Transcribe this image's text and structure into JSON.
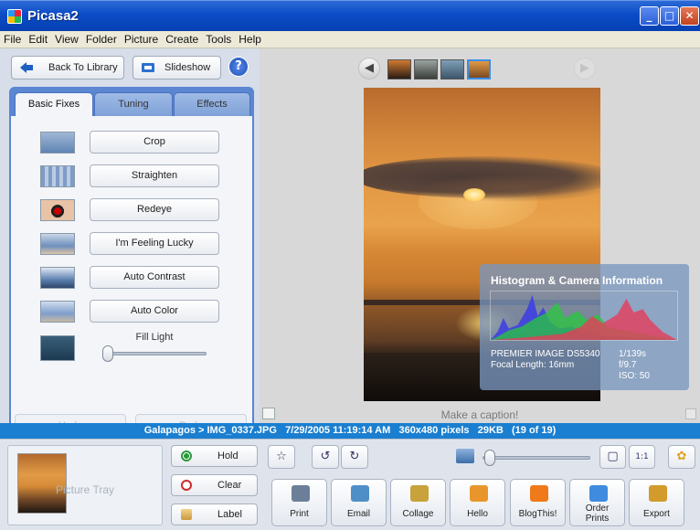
{
  "window": {
    "title": "Picasa2",
    "minimize": "_",
    "maximize": "□",
    "close": "✕"
  },
  "menu": [
    "File",
    "Edit",
    "View",
    "Folder",
    "Picture",
    "Create",
    "Tools",
    "Help"
  ],
  "toolbar": {
    "back_label": "Back To Library",
    "slideshow_label": "Slideshow",
    "help_label": "?"
  },
  "tabs": [
    {
      "label": "Basic Fixes",
      "active": true
    },
    {
      "label": "Tuning",
      "active": false
    },
    {
      "label": "Effects",
      "active": false
    }
  ],
  "fixes": [
    "Crop",
    "Straighten",
    "Redeye",
    "I'm Feeling Lucky",
    "Auto Contrast",
    "Auto Color"
  ],
  "fill_light": {
    "label": "Fill Light",
    "level": 0.0
  },
  "edit_actions": {
    "undo": "Undo",
    "redo": "Redo"
  },
  "filmstrip": {
    "prev_icon": "arrow-left-icon",
    "next_icon": "arrow-right-icon",
    "count": 4,
    "selected_index": 3
  },
  "histogram": {
    "title": "Histogram & Camera Information",
    "camera_model": "PREMIER IMAGE  DS5340",
    "focal_length": "Focal Length:  16mm",
    "shutter": "1/139s",
    "aperture": "f/9.7",
    "iso": "ISO: 50"
  },
  "caption": {
    "placeholder": "Make a caption!"
  },
  "status": {
    "path": "Galapagos > IMG_0337.JPG",
    "datetime": "7/29/2005 11:19:14 AM",
    "dimensions": "360x480 pixels",
    "size": "29KB",
    "position": "(19 of 19)"
  },
  "tray": {
    "label": "Picture Tray",
    "hold": "Hold",
    "clear": "Clear",
    "label_btn": "Label"
  },
  "view_controls": {
    "one_to_one": "1:1"
  },
  "actions": [
    {
      "label": "Print",
      "icon": "printer-icon",
      "color": "#6b7f99"
    },
    {
      "label": "Email",
      "icon": "email-icon",
      "color": "#4f8fc7"
    },
    {
      "label": "Collage",
      "icon": "collage-icon",
      "color": "#c8a23a"
    },
    {
      "label": "Hello",
      "icon": "hello-icon",
      "color": "#e8962c"
    },
    {
      "label": "BlogThis!",
      "icon": "blogger-icon",
      "color": "#f07a1a"
    },
    {
      "label": "Order Prints",
      "icon": "order-prints-icon",
      "color": "#3f8be0"
    },
    {
      "label": "Export",
      "icon": "export-icon",
      "color": "#d39a2c"
    }
  ],
  "colors": {
    "title_bar": "#0a4cc6",
    "status_bar": "#1a7fd0",
    "tab_border": "#5a86d2"
  }
}
